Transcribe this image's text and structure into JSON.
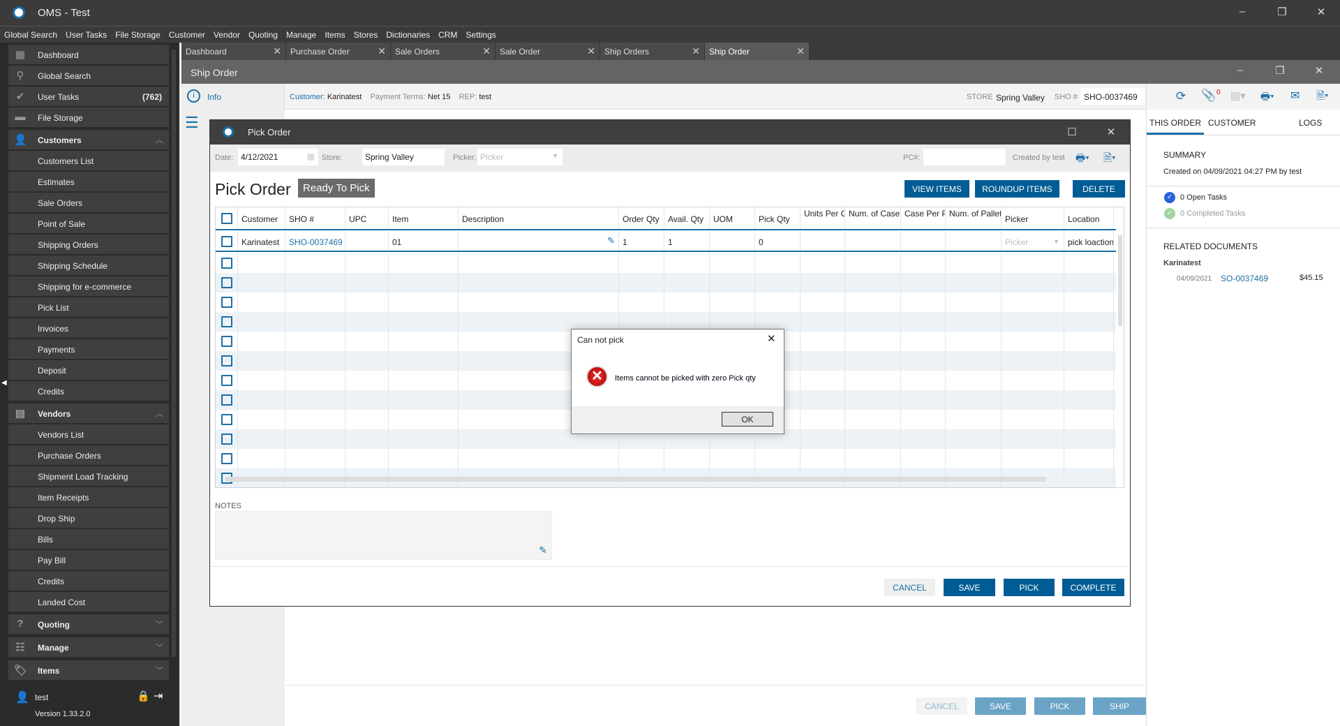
{
  "app": {
    "title": "OMS - Test",
    "icon": "app-logo-icon"
  },
  "menu": [
    "Global Search",
    "User Tasks",
    "File Storage",
    "Customer",
    "Vendor",
    "Quoting",
    "Manage",
    "Items",
    "Stores",
    "Dictionaries",
    "CRM",
    "Settings"
  ],
  "sidebar": {
    "top": [
      {
        "label": "Dashboard",
        "icon": "dashboard-icon"
      },
      {
        "label": "Global Search",
        "icon": "search-icon"
      },
      {
        "label": "User Tasks",
        "icon": "check-circle-icon",
        "badge": "(762)"
      },
      {
        "label": "File Storage",
        "icon": "folder-icon"
      }
    ],
    "customers": {
      "label": "Customers",
      "items": [
        "Customers List",
        "Estimates",
        "Sale Orders",
        "Point of Sale",
        "Shipping Orders",
        "Shipping Schedule",
        "Shipping for e-commerce",
        "Pick List",
        "Invoices",
        "Payments",
        "Deposit",
        "Credits"
      ]
    },
    "vendors": {
      "label": "Vendors",
      "items": [
        "Vendors List",
        "Purchase Orders",
        "Shipment Load Tracking",
        "Item Receipts",
        "Drop Ship",
        "Bills",
        "Pay Bill",
        "Credits",
        "Landed Cost"
      ]
    },
    "bottom_groups": [
      "Quoting",
      "Manage",
      "Items"
    ],
    "user": "test",
    "version": "Version 1.33.2.0"
  },
  "tabs": [
    {
      "label": "Dashboard"
    },
    {
      "label": "Purchase Order"
    },
    {
      "label": "Sale Orders"
    },
    {
      "label": "Sale Order"
    },
    {
      "label": "Ship Orders"
    },
    {
      "label": "Ship Order",
      "active": true
    }
  ],
  "ship_order": {
    "title": "Ship Order",
    "info_tab": "Info",
    "customer_label": "Customer:",
    "customer": "Karinatest",
    "terms_label": "Payment Terms:",
    "terms": "Net 15",
    "rep_label": "REP:",
    "rep": "test",
    "store_label": "STORE",
    "store": "Spring Valley",
    "sho_label": "SHO #",
    "sho": "SHO-0037469",
    "attachments_count": "0",
    "buttons": {
      "cancel": "CANCEL",
      "save": "SAVE",
      "pick": "PICK",
      "ship": "SHIP"
    }
  },
  "right_panel": {
    "tabs": [
      "THIS ORDER",
      "CUSTOMER",
      "LOGS"
    ],
    "active_tab": "THIS ORDER",
    "summary_title": "SUMMARY",
    "created": "Created on 04/09/2021 04:27 PM by test",
    "open_tasks": "0 Open Tasks",
    "completed_tasks": "0 Completed Tasks",
    "related_title": "RELATED DOCUMENTS",
    "related_customer": "Karinatest",
    "related": [
      {
        "date": "04/09/2021",
        "doc": "SO-0037469",
        "amount": "$45.15"
      }
    ]
  },
  "pick_order": {
    "window_title": "Pick Order",
    "date_label": "Date:",
    "date": "4/12/2021",
    "store_label": "Store:",
    "store": "Spring Valley",
    "picker_label": "Picker:",
    "picker_placeholder": "Picker",
    "pc_label": "PC#:",
    "pc_value": "",
    "created_by": "Created by test",
    "heading": "Pick Order",
    "status": "Ready To Pick",
    "buttons": {
      "view_items": "VIEW ITEMS",
      "roundup_items": "ROUNDUP ITEMS",
      "delete": "DELETE",
      "cancel": "CANCEL",
      "save": "SAVE",
      "pick": "PICK",
      "complete": "COMPLETE"
    },
    "columns": [
      "",
      "Customer",
      "SHO #",
      "UPC",
      "Item",
      "Description",
      "Order Qty",
      "Avail. Qty",
      "UOM",
      "Pick Qty",
      "Units Per Case",
      "Num. of Cases",
      "Case Per Pallet",
      "Num. of Pallets",
      "Picker",
      "Location"
    ],
    "rows": [
      {
        "customer": "Karinatest",
        "sho": "SHO-0037469",
        "upc": "",
        "item": "01",
        "description": "",
        "order_qty": "1",
        "avail_qty": "1",
        "uom": "",
        "pick_qty": "0",
        "units_per_case": "",
        "num_cases": "",
        "case_per_pallet": "",
        "num_pallets": "",
        "picker": "Picker",
        "location": "pick loaction"
      }
    ],
    "notes_label": "NOTES",
    "notes": ""
  },
  "message_box": {
    "title": "Can not pick",
    "message": "Items cannot be picked with zero Pick qty",
    "ok": "OK",
    "icon": "error-icon"
  }
}
